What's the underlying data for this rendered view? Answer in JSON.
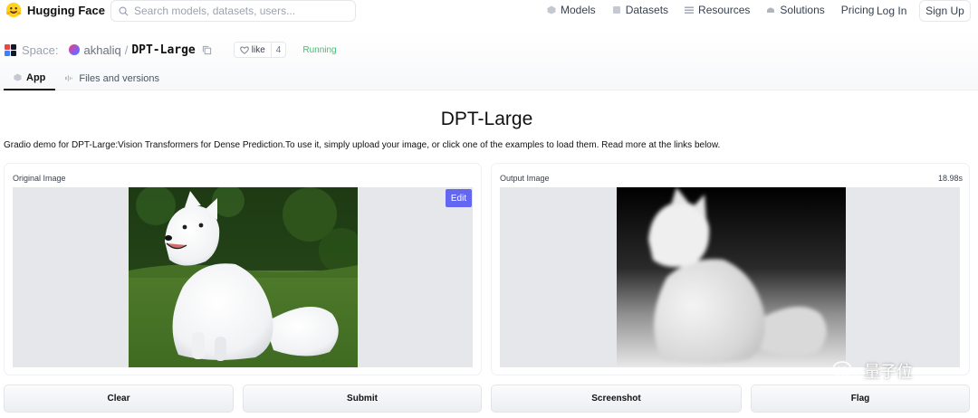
{
  "header": {
    "brand": "Hugging Face",
    "search_placeholder": "Search models, datasets, users...",
    "nav": [
      {
        "label": "Models",
        "icon": "models-icon"
      },
      {
        "label": "Datasets",
        "icon": "datasets-icon"
      },
      {
        "label": "Resources",
        "icon": "resources-icon"
      },
      {
        "label": "Solutions",
        "icon": "solutions-icon"
      },
      {
        "label": "Pricing",
        "icon": ""
      }
    ],
    "login": "Log In",
    "signup": "Sign Up"
  },
  "space": {
    "label": "Space:",
    "owner": "akhaliq",
    "separator": "/",
    "repo": "DPT-Large",
    "like_label": "like",
    "like_count": "4",
    "status": "Running",
    "status_color": "#3fbf6f"
  },
  "tabs": [
    {
      "label": "App",
      "active": true
    },
    {
      "label": "Files and versions",
      "active": false
    }
  ],
  "app": {
    "title": "DPT-Large",
    "description": "Gradio demo for DPT-Large:Vision Transformers for Dense Prediction.To use it, simply upload your image, or click one of the examples to load them. Read more at the links below.",
    "input_label": "Original Image",
    "edit_label": "Edit",
    "output_label": "Output Image",
    "timing": "18.98s",
    "buttons": {
      "clear": "Clear",
      "submit": "Submit",
      "screenshot": "Screenshot",
      "flag": "Flag"
    },
    "accent_color": "#6366f1"
  },
  "watermark": {
    "text": "量子位"
  }
}
